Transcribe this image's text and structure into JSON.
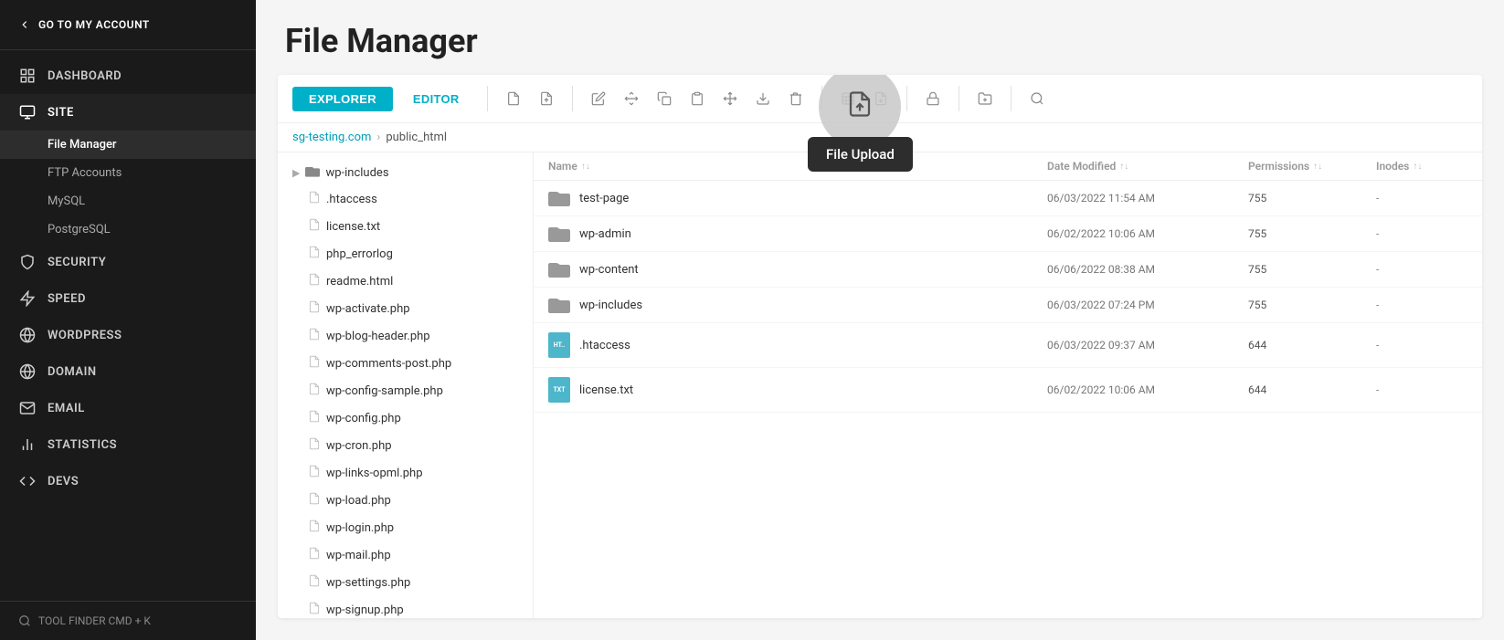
{
  "sidebar": {
    "top_link": "GO TO MY ACCOUNT",
    "items": [
      {
        "id": "dashboard",
        "label": "DASHBOARD",
        "icon": "grid"
      },
      {
        "id": "site",
        "label": "SITE",
        "icon": "monitor",
        "active": true,
        "children": [
          {
            "id": "file-manager",
            "label": "File Manager",
            "active": true
          },
          {
            "id": "ftp-accounts",
            "label": "FTP Accounts"
          },
          {
            "id": "mysql",
            "label": "MySQL"
          },
          {
            "id": "postgresql",
            "label": "PostgreSQL"
          }
        ]
      },
      {
        "id": "security",
        "label": "SECURITY",
        "icon": "shield"
      },
      {
        "id": "speed",
        "label": "SPEED",
        "icon": "zap"
      },
      {
        "id": "wordpress",
        "label": "WORDPRESS",
        "icon": "wp"
      },
      {
        "id": "domain",
        "label": "DOMAIN",
        "icon": "globe"
      },
      {
        "id": "email",
        "label": "EMAIL",
        "icon": "mail"
      },
      {
        "id": "statistics",
        "label": "STATISTICS",
        "icon": "bar-chart"
      },
      {
        "id": "devs",
        "label": "DEVS",
        "icon": "code"
      }
    ],
    "footer": "TOOL FINDER CMD + K"
  },
  "page": {
    "title": "File Manager"
  },
  "toolbar": {
    "explorer_label": "EXPLORER",
    "editor_label": "EDITOR",
    "file_upload_tooltip": "File Upload"
  },
  "breadcrumb": {
    "root": "sg-testing.com",
    "path": "public_html"
  },
  "file_list": {
    "columns": [
      {
        "label": "Name"
      },
      {
        "label": "Date Modified"
      },
      {
        "label": "Permissions"
      },
      {
        "label": "Inodes"
      }
    ],
    "rows": [
      {
        "name": "test-page",
        "type": "folder",
        "date": "06/03/2022 11:54 AM",
        "permissions": "755",
        "inodes": "-"
      },
      {
        "name": "wp-admin",
        "type": "folder",
        "date": "06/02/2022 10:06 AM",
        "permissions": "755",
        "inodes": "-"
      },
      {
        "name": "wp-content",
        "type": "folder",
        "date": "06/06/2022 08:38 AM",
        "permissions": "755",
        "inodes": "-"
      },
      {
        "name": "wp-includes",
        "type": "folder",
        "date": "06/03/2022 07:24 PM",
        "permissions": "755",
        "inodes": "-"
      },
      {
        "name": ".htaccess",
        "type": "htaccess",
        "date": "06/03/2022 09:37 AM",
        "permissions": "644",
        "inodes": "-"
      },
      {
        "name": "license.txt",
        "type": "txt",
        "date": "06/02/2022 10:06 AM",
        "permissions": "644",
        "inodes": "-"
      }
    ]
  },
  "tree": {
    "items": [
      {
        "name": "wp-includes",
        "type": "folder",
        "expandable": true
      },
      {
        "name": ".htaccess",
        "type": "file"
      },
      {
        "name": "license.txt",
        "type": "file"
      },
      {
        "name": "php_errorlog",
        "type": "file"
      },
      {
        "name": "readme.html",
        "type": "file"
      },
      {
        "name": "wp-activate.php",
        "type": "file"
      },
      {
        "name": "wp-blog-header.php",
        "type": "file"
      },
      {
        "name": "wp-comments-post.php",
        "type": "file"
      },
      {
        "name": "wp-config-sample.php",
        "type": "file"
      },
      {
        "name": "wp-config.php",
        "type": "file"
      },
      {
        "name": "wp-cron.php",
        "type": "file"
      },
      {
        "name": "wp-links-opml.php",
        "type": "file"
      },
      {
        "name": "wp-load.php",
        "type": "file"
      },
      {
        "name": "wp-login.php",
        "type": "file"
      },
      {
        "name": "wp-mail.php",
        "type": "file"
      },
      {
        "name": "wp-settings.php",
        "type": "file"
      },
      {
        "name": "wp-signup.php",
        "type": "file"
      }
    ]
  }
}
